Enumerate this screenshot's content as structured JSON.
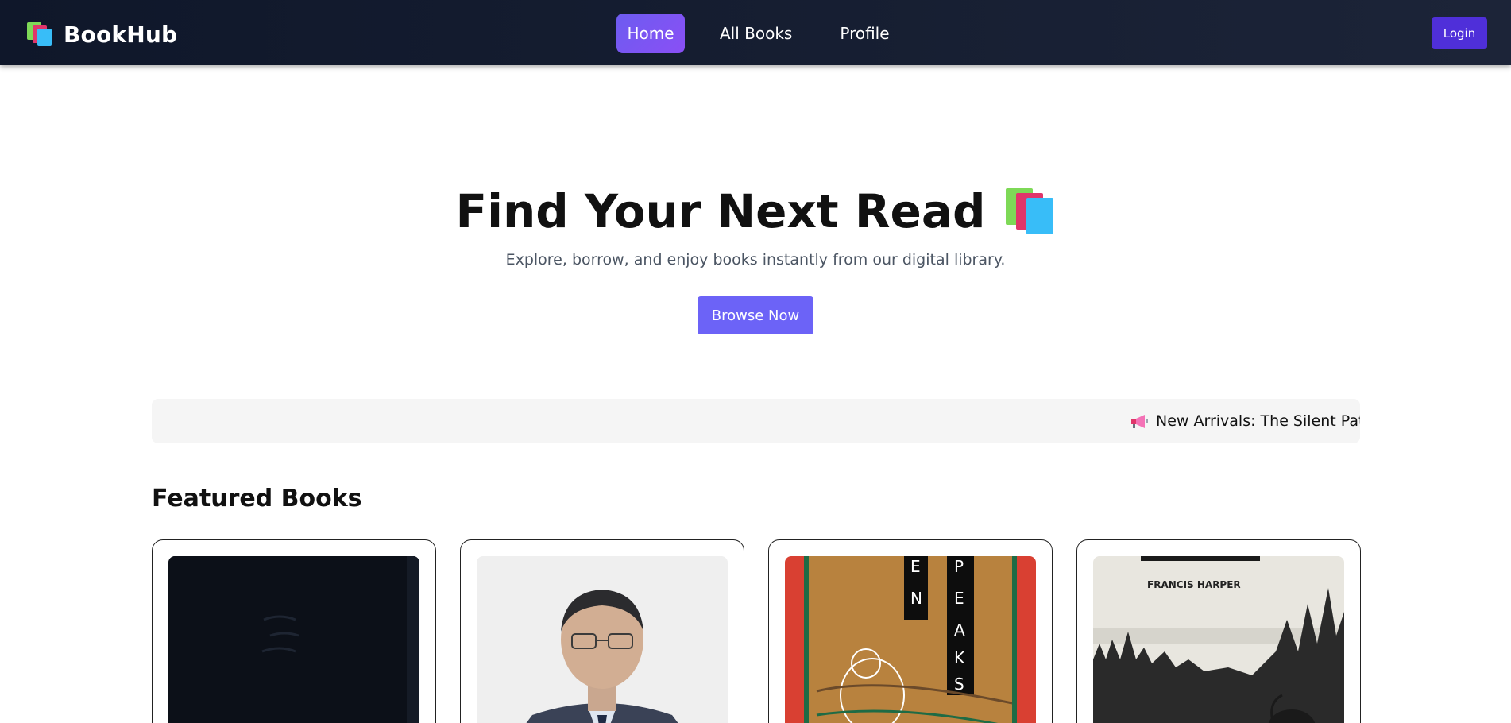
{
  "navbar": {
    "brand": "BookHub",
    "brand_icon": "books-icon",
    "links": [
      {
        "label": "Home",
        "active": true
      },
      {
        "label": "All Books",
        "active": false
      },
      {
        "label": "Profile",
        "active": false
      }
    ],
    "login_label": "Login"
  },
  "hero": {
    "title": "Find Your Next Read",
    "title_icon": "books-icon",
    "subtitle": "Explore, borrow, and enjoy books instantly from our digital library.",
    "cta_label": "Browse Now"
  },
  "ticker": {
    "icon": "megaphone-icon",
    "text": "New Arrivals: The Silent Pati"
  },
  "featured": {
    "title": "Featured Books",
    "books": [
      {
        "cover": "dark-cover"
      },
      {
        "cover": "author-portrait"
      },
      {
        "cover": "peaks-illustration"
      },
      {
        "cover": "forest-sketch"
      }
    ]
  },
  "colors": {
    "nav_bg": "#0f172a",
    "active_link": "#7c55f3",
    "login_bg": "#4f2fd9",
    "cta_bg": "#6c63f7",
    "ticker_bg": "#f5f5f5"
  }
}
